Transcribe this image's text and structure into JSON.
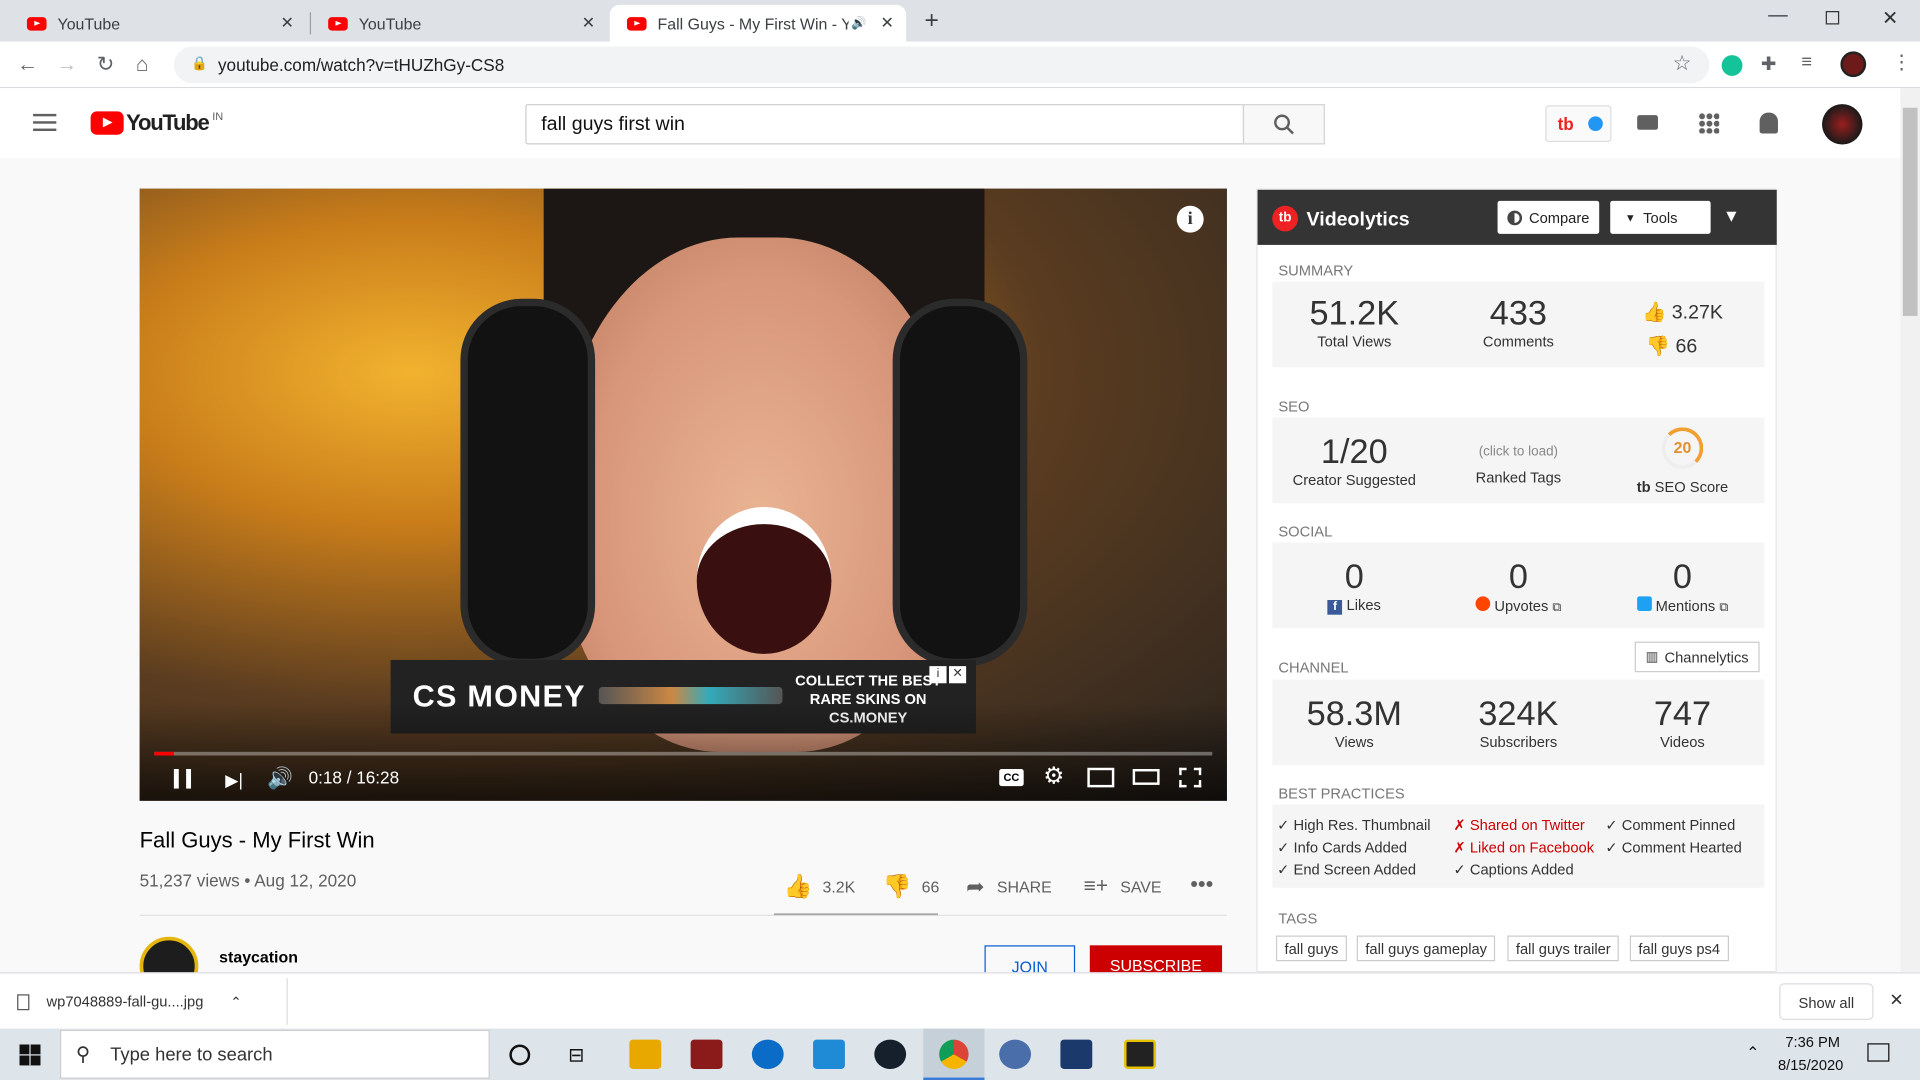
{
  "browser": {
    "tabs": [
      {
        "title": "YouTube"
      },
      {
        "title": "YouTube"
      },
      {
        "title": "Fall Guys - My First Win - YouTube"
      }
    ],
    "url": "youtube.com/watch?v=tHUZhGy-CS8"
  },
  "youtube": {
    "logo_text": "YouTube",
    "region": "IN",
    "search_value": "fall guys first win"
  },
  "player": {
    "time": "0:18 / 16:28",
    "progress": 0.018,
    "ad": {
      "brand": "CS MONEY",
      "text": "COLLECT THE BEST RARE SKINS ON CS.MONEY"
    }
  },
  "video": {
    "title": "Fall Guys - My First Win",
    "stats": "51,237 views • Aug 12, 2020",
    "likes": "3.2K",
    "dislikes": "66",
    "share_label": "SHARE",
    "save_label": "SAVE",
    "channel": "staycation",
    "join_label": "JOIN",
    "subscribe_label": "SUBSCRIBE"
  },
  "videolytics": {
    "title": "Videolytics",
    "compare_label": "Compare",
    "tools_label": "Tools",
    "summary": {
      "heading": "SUMMARY",
      "views": "51.2K",
      "views_label": "Total Views",
      "comments": "433",
      "comments_label": "Comments",
      "likes": "3.27K",
      "dislikes": "66"
    },
    "seo": {
      "heading": "SEO",
      "suggested": "1/20",
      "suggested_label": "Creator Suggested",
      "ranked_hint": "(click to load)",
      "ranked_label": "Ranked Tags",
      "score": "20",
      "score_label": "SEO Score"
    },
    "social": {
      "heading": "SOCIAL",
      "likes": "0",
      "likes_label": "Likes",
      "upvotes": "0",
      "upvotes_label": "Upvotes",
      "mentions": "0",
      "mentions_label": "Mentions"
    },
    "channel": {
      "heading": "CHANNEL",
      "channelytics_label": "Channelytics",
      "views": "58.3M",
      "views_label": "Views",
      "subs": "324K",
      "subs_label": "Subscribers",
      "videos": "747",
      "videos_label": "Videos"
    },
    "best_practices": {
      "heading": "BEST PRACTICES",
      "items": [
        "✓ High Res. Thumbnail",
        "✓ Info Cards Added",
        "✓ End Screen Added",
        "✗ Shared on Twitter",
        "✗ Liked on Facebook",
        "✓ Captions Added",
        "✓ Comment Pinned",
        "✓ Comment Hearted"
      ]
    },
    "tags": {
      "heading": "TAGS",
      "items": [
        "fall guys",
        "fall guys gameplay",
        "fall guys trailer",
        "fall guys ps4"
      ]
    }
  },
  "download": {
    "file": "wp7048889-fall-gu....jpg",
    "show_all": "Show all"
  },
  "taskbar": {
    "search_placeholder": "Type here to search",
    "time": "7:36 PM",
    "date": "8/15/2020"
  }
}
